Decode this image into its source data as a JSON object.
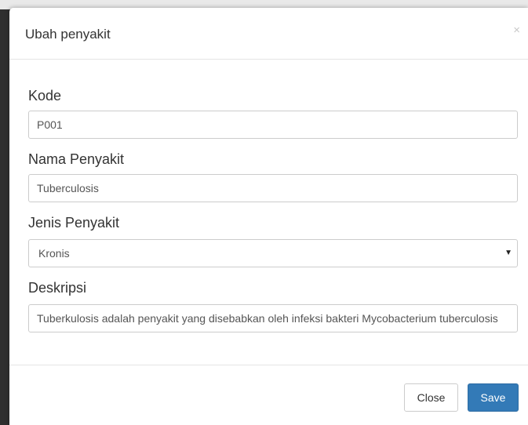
{
  "modal": {
    "title": "Ubah penyakit",
    "close_icon": "×",
    "fields": {
      "kode": {
        "label": "Kode",
        "value": "P001"
      },
      "nama": {
        "label": "Nama Penyakit",
        "value": "Tuberculosis"
      },
      "jenis": {
        "label": "Jenis Penyakit",
        "selected": "Kronis"
      },
      "deskripsi": {
        "label": "Deskripsi",
        "value": "Tuberkulosis adalah penyakit yang disebabkan oleh infeksi bakteri Mycobacterium tuberculosis"
      }
    },
    "buttons": {
      "close_label": "Close",
      "save_label": "Save"
    }
  },
  "colors": {
    "primary": "#337ab7",
    "border": "#cccccc",
    "text": "#333333"
  }
}
